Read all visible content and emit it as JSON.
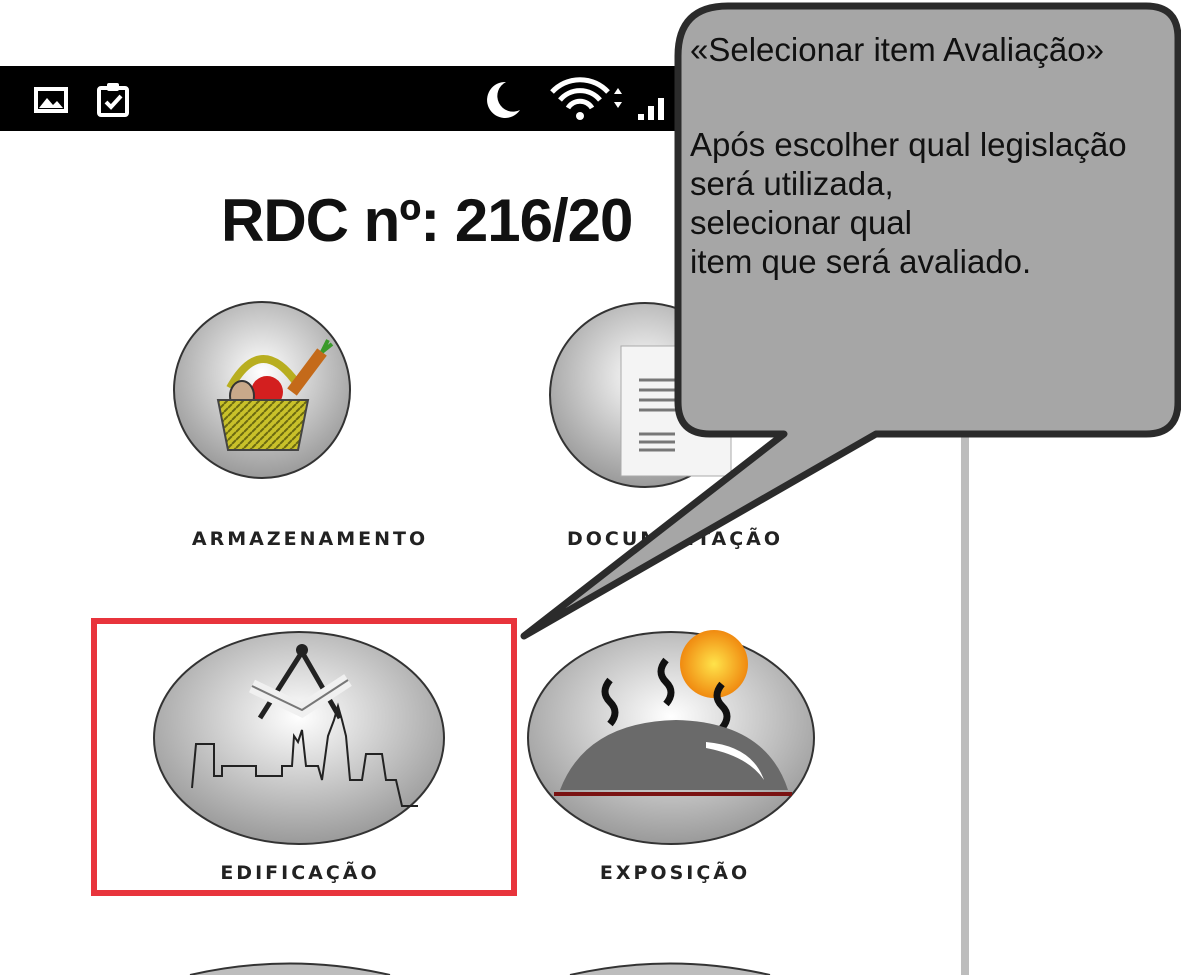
{
  "status_bar": {
    "left_icons": [
      "image-icon",
      "clipboard-check-icon"
    ],
    "right_icons": [
      "moon-icon",
      "wifi-icon",
      "signal-icon"
    ]
  },
  "page": {
    "title": "RDC nº: 216/20"
  },
  "tiles": [
    {
      "label": "ARMAZENAMENTO",
      "icon": "basket-icon"
    },
    {
      "label": "DOCUMENTAÇÃO",
      "icon": "document-icon"
    },
    {
      "label": "EDIFICAÇÃO",
      "icon": "building-compass-icon"
    },
    {
      "label": "EXPOSIÇÃO",
      "icon": "food-cloche-icon"
    }
  ],
  "callout": {
    "heading": "«Selecionar item Avaliação»",
    "lines": [
      "Após escolher qual legislação",
      "será utilizada,",
      "selecionar qual",
      "item que será avaliado."
    ]
  },
  "colors": {
    "highlight": "#e8343c",
    "callout_fill": "#a6a6a6",
    "callout_border": "#2b2b2b",
    "status_bar": "#000000"
  }
}
